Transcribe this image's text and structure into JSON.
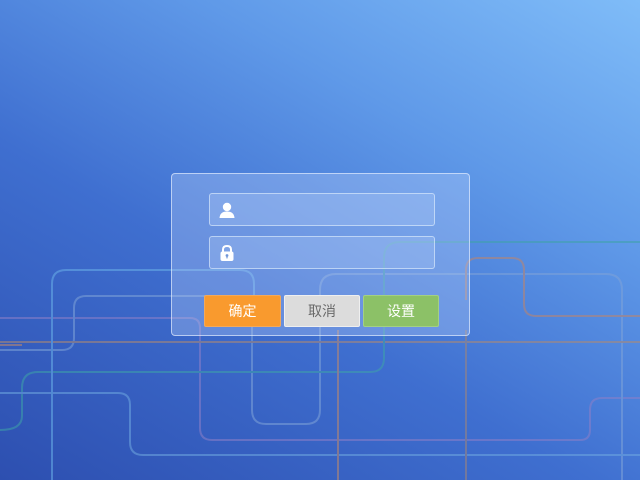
{
  "login": {
    "username": {
      "value": "",
      "placeholder": "",
      "icon": "user-icon"
    },
    "password": {
      "value": "",
      "placeholder": "",
      "icon": "lock-icon"
    },
    "buttons": {
      "ok_label": "确定",
      "cancel_label": "取消",
      "settings_label": "设置"
    }
  },
  "colors": {
    "ok_button": "#f99a2e",
    "cancel_button": "#dcdcdc",
    "settings_button": "#8cc167",
    "background_light": "#7fbcf8",
    "background_dark": "#2d4fb0"
  }
}
